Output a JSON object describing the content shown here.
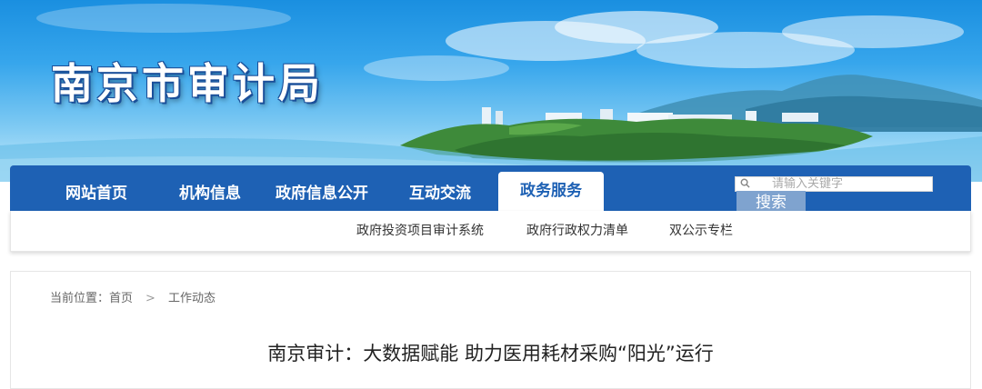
{
  "banner": {
    "site_title": "南京市审计局"
  },
  "nav": {
    "items": [
      {
        "label": "网站首页"
      },
      {
        "label": "机构信息"
      },
      {
        "label": "政府信息公开"
      },
      {
        "label": "互动交流"
      },
      {
        "label": "政务服务",
        "active": true
      }
    ],
    "search": {
      "placeholder": "请输入关键字",
      "button_label": "搜索"
    }
  },
  "subnav": {
    "items": [
      {
        "label": "政府投资项目审计系统"
      },
      {
        "label": "政府行政权力清单"
      },
      {
        "label": "双公示专栏"
      }
    ]
  },
  "breadcrumb": {
    "prefix": "当前位置：",
    "home": "首页",
    "separator": ">",
    "current": "工作动态"
  },
  "article": {
    "title": "南京审计：大数据赋能 助力医用耗材采购“阳光”运行"
  },
  "colors": {
    "nav_bg": "#1e61b4",
    "search_button": "#7fa3cf"
  }
}
